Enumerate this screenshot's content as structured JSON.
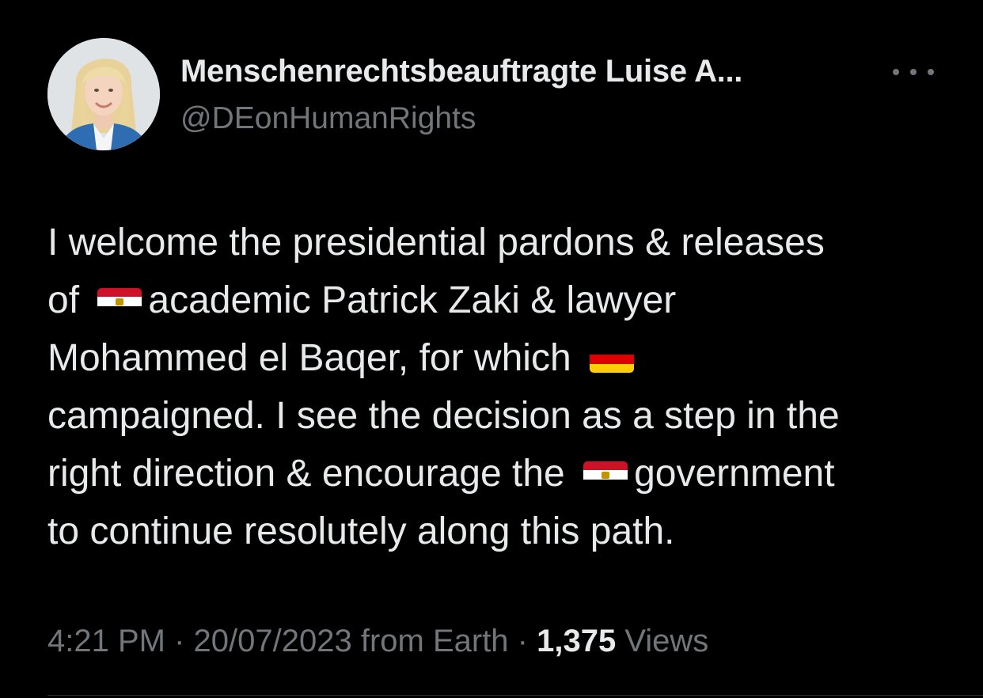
{
  "author": {
    "display_name": "Menschenrechtsbeauftragte Luise A...",
    "handle": "@DEonHumanRights"
  },
  "tweet": {
    "lines": [
      {
        "before": "I welcome the presidential pardons & releases",
        "flag": "",
        "after": ""
      },
      {
        "before": "of ",
        "flag": "egypt-flag-icon",
        "after": "academic Patrick Zaki & lawyer"
      },
      {
        "before": "Mohammed el Baqer, for which ",
        "flag": "germany-flag-icon",
        "after": ""
      },
      {
        "before": "campaigned. I see the decision as a step in the",
        "flag": "",
        "after": ""
      },
      {
        "before": "right direction & encourage the ",
        "flag": "egypt-flag-icon",
        "after": "government"
      },
      {
        "before": "to continue resolutely along this path.",
        "flag": "",
        "after": ""
      }
    ]
  },
  "meta": {
    "time": "4:21 PM",
    "sep1": " · ",
    "date": "20/07/2023",
    "source": " from Earth",
    "sep2": " · ",
    "views_count": "1,375",
    "views_label": " Views"
  },
  "icons": {
    "more": "more-options-icon",
    "avatar": "avatar"
  },
  "colors": {
    "background": "#000000",
    "text_primary": "#e7e9ea",
    "text_secondary": "#71767b",
    "divider": "#2f3336",
    "egypt_red": "#ce1126",
    "egypt_white": "#ffffff",
    "egypt_black": "#000000",
    "germany_black": "#000000",
    "germany_red": "#dd0000",
    "germany_gold": "#ffce00"
  }
}
